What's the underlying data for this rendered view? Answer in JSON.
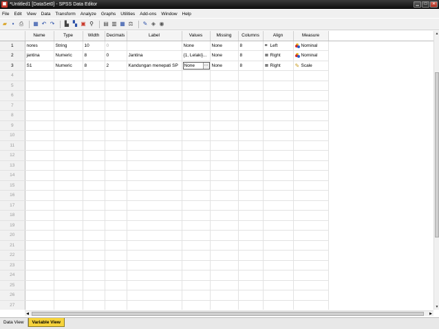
{
  "window": {
    "title": "*Untitled1 [DataSet0] - SPSS Data Editor",
    "app_icon": "spss-logo-icon",
    "controls": [
      "minimize-icon",
      "maximize-icon",
      "close-icon"
    ]
  },
  "menu": [
    "File",
    "Edit",
    "View",
    "Data",
    "Transform",
    "Analyze",
    "Graphs",
    "Utilities",
    "Add-ons",
    "Window",
    "Help"
  ],
  "toolbar": {
    "icons": [
      "open-icon",
      "save-icon",
      "print-icon",
      "dialog-recall-icon",
      "undo-icon",
      "redo-icon",
      "goto-case-icon",
      "goto-variable-icon",
      "variables-icon",
      "find-icon",
      "insert-cases-icon",
      "insert-variable-icon",
      "split-file-icon",
      "weight-cases-icon",
      "select-cases-icon",
      "value-labels-icon",
      "use-sets-icon",
      "show-all-variables-icon"
    ]
  },
  "grid": {
    "columns": [
      "Name",
      "Type",
      "Width",
      "Decimals",
      "Label",
      "Values",
      "Missing",
      "Columns",
      "Align",
      "Measure"
    ],
    "rows": [
      {
        "num": "1",
        "name": "nores",
        "type": "String",
        "width": "10",
        "decimals": "0",
        "label": "",
        "values": "None",
        "missing": "None",
        "columns": "8",
        "align": "Left",
        "measure": "Nominal"
      },
      {
        "num": "2",
        "name": "jantina",
        "type": "Numeric",
        "width": "8",
        "decimals": "0",
        "label": "Jantina",
        "values": "{1, Lelaki}...",
        "missing": "None",
        "columns": "8",
        "align": "Right",
        "measure": "Nominal"
      },
      {
        "num": "3",
        "name": "S1",
        "type": "Numeric",
        "width": "8",
        "decimals": "2",
        "label": "Kandungan menepati SP",
        "values": "None",
        "missing": "None",
        "columns": "8",
        "align": "Right",
        "measure": "Scale"
      }
    ],
    "empty_rows": [
      "4",
      "5",
      "6",
      "7",
      "8",
      "9",
      "10",
      "11",
      "12",
      "13",
      "14",
      "15",
      "16",
      "17",
      "18",
      "19",
      "20",
      "21",
      "22",
      "23",
      "24",
      "25",
      "26",
      "27"
    ]
  },
  "tabs": [
    "Data View",
    "Variable View"
  ],
  "active_tab": "Variable View"
}
